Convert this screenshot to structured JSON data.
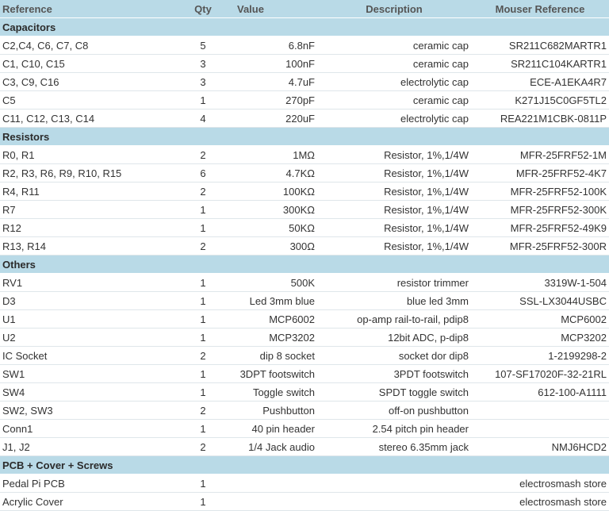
{
  "headers": {
    "reference": "Reference",
    "qty": "Qty",
    "value": "Value",
    "description": "Description",
    "mouser": "Mouser Reference"
  },
  "sections": [
    {
      "title": "Capacitors",
      "rows": [
        {
          "ref": "C2,C4, C6, C7, C8",
          "qty": "5",
          "value": "6.8nF",
          "desc": "ceramic cap",
          "mouser": "SR211C682MARTR1"
        },
        {
          "ref": "C1, C10, C15",
          "qty": "3",
          "value": "100nF",
          "desc": "ceramic cap",
          "mouser": "SR211C104KARTR1"
        },
        {
          "ref": "C3, C9, C16",
          "qty": "3",
          "value": "4.7uF",
          "desc": "electrolytic cap",
          "mouser": "ECE-A1EKA4R7"
        },
        {
          "ref": "C5",
          "qty": "1",
          "value": "270pF",
          "desc": "ceramic cap",
          "mouser": "K271J15C0GF5TL2"
        },
        {
          "ref": "C11, C12, C13, C14",
          "qty": "4",
          "value": "220uF",
          "desc": "electrolytic cap",
          "mouser": "REA221M1CBK-0811P"
        }
      ]
    },
    {
      "title": "Resistors",
      "rows": [
        {
          "ref": "R0, R1",
          "qty": "2",
          "value": "1MΩ",
          "desc": "Resistor, 1%,1/4W",
          "mouser": "MFR-25FRF52-1M"
        },
        {
          "ref": "R2, R3, R6, R9, R10, R15",
          "qty": "6",
          "value": "4.7KΩ",
          "desc": "Resistor, 1%,1/4W",
          "mouser": "MFR-25FRF52-4K7"
        },
        {
          "ref": "R4, R11",
          "qty": "2",
          "value": "100KΩ",
          "desc": "Resistor, 1%,1/4W",
          "mouser": "MFR-25FRF52-100K"
        },
        {
          "ref": "R7",
          "qty": "1",
          "value": "300KΩ",
          "desc": "Resistor, 1%,1/4W",
          "mouser": "MFR-25FRF52-300K"
        },
        {
          "ref": "R12",
          "qty": "1",
          "value": "50KΩ",
          "desc": "Resistor, 1%,1/4W",
          "mouser": "MFR-25FRF52-49K9"
        },
        {
          "ref": "R13, R14",
          "qty": "2",
          "value": "300Ω",
          "desc": "Resistor, 1%,1/4W",
          "mouser": "MFR-25FRF52-300R"
        }
      ]
    },
    {
      "title": "Others",
      "rows": [
        {
          "ref": "RV1",
          "qty": "1",
          "value": "500K",
          "desc": "resistor trimmer",
          "mouser": "3319W-1-504"
        },
        {
          "ref": "D3",
          "qty": "1",
          "value": "Led 3mm blue",
          "desc": "blue led 3mm",
          "mouser": "SSL-LX3044USBC"
        },
        {
          "ref": "U1",
          "qty": "1",
          "value": "MCP6002",
          "desc": "op-amp rail-to-rail, pdip8",
          "mouser": "MCP6002"
        },
        {
          "ref": "U2",
          "qty": "1",
          "value": "MCP3202",
          "desc": "12bit ADC, p-dip8",
          "mouser": "MCP3202"
        },
        {
          "ref": "IC Socket",
          "qty": "2",
          "value": "dip 8 socket",
          "desc": "socket dor dip8",
          "mouser": "1-2199298-2"
        },
        {
          "ref": "SW1",
          "qty": "1",
          "value": "3DPT footswitch",
          "desc": "3PDT footswitch",
          "mouser": "107-SF17020F-32-21RL"
        },
        {
          "ref": "SW4",
          "qty": "1",
          "value": "Toggle switch",
          "desc": "SPDT toggle switch",
          "mouser": "612-100-A1111"
        },
        {
          "ref": "SW2, SW3",
          "qty": "2",
          "value": "Pushbutton",
          "desc": "off-on pushbutton",
          "mouser": ""
        },
        {
          "ref": "Conn1",
          "qty": "1",
          "value": "40 pin header",
          "desc": "2.54 pitch pin header",
          "mouser": ""
        },
        {
          "ref": "J1, J2",
          "qty": "2",
          "value": "1/4 Jack audio",
          "desc": "stereo 6.35mm jack",
          "mouser": "NMJ6HCD2"
        }
      ]
    },
    {
      "title": "PCB + Cover + Screws",
      "rows": [
        {
          "ref": "Pedal Pi PCB",
          "qty": "1",
          "value": "",
          "desc": "",
          "mouser": "electrosmash store"
        },
        {
          "ref": "Acrylic Cover",
          "qty": "1",
          "value": "",
          "desc": "",
          "mouser": "electrosmash store"
        }
      ]
    }
  ]
}
